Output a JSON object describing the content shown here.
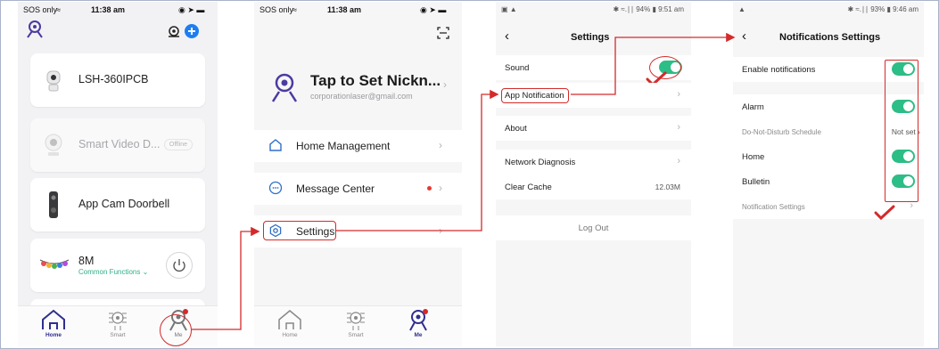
{
  "screen1": {
    "status": {
      "left": "SOS only",
      "time": "11:38 am"
    },
    "devices": [
      {
        "name": "LSH-360IPCB",
        "icon": "ptz-camera-icon"
      },
      {
        "name": "Smart Video D...",
        "badge": "Offline",
        "icon": "smart-camera-icon"
      },
      {
        "name": "App Cam Doorbell",
        "icon": "doorbell-icon"
      },
      {
        "name": "8M",
        "sub": "Common Functions ⌄",
        "icon": "light-string-icon"
      }
    ],
    "tabs": {
      "home": "Home",
      "smart": "Smart",
      "me": "Me"
    }
  },
  "screen2": {
    "status": {
      "left": "SOS only",
      "time": "11:38 am"
    },
    "nickname": "Tap to Set Nickn...",
    "email": "corporationlaser@gmail.com",
    "menu": {
      "home": "Home Management",
      "messages": "Message Center",
      "settings": "Settings"
    },
    "tabs": {
      "home": "Home",
      "smart": "Smart",
      "me": "Me"
    }
  },
  "screen3": {
    "status": {
      "right": "✱ ≈.∣∣ 94% ▮ 9:51 am"
    },
    "title": "Settings",
    "rows": {
      "sound": "Sound",
      "app_notification": "App Notification",
      "about": "About",
      "network": "Network Diagnosis",
      "cache": "Clear Cache",
      "cache_size": "12.03M"
    },
    "logout": "Log Out"
  },
  "screen4": {
    "status": {
      "right": "✱ ≈.∣∣ 93% ▮ 9:46 am"
    },
    "title": "Notifications Settings",
    "rows": {
      "enable": "Enable notifications",
      "alarm": "Alarm",
      "dnd": "Do-Not-Disturb Schedule",
      "dnd_value": "Not set",
      "home": "Home",
      "bulletin": "Bulletin",
      "notif_settings": "Notification Settings"
    }
  },
  "colors": {
    "accent_green": "#2dbd86",
    "brand_purple": "#2f2f8f",
    "highlight_red": "#d42a2a",
    "blue_add": "#1e7ef0"
  }
}
